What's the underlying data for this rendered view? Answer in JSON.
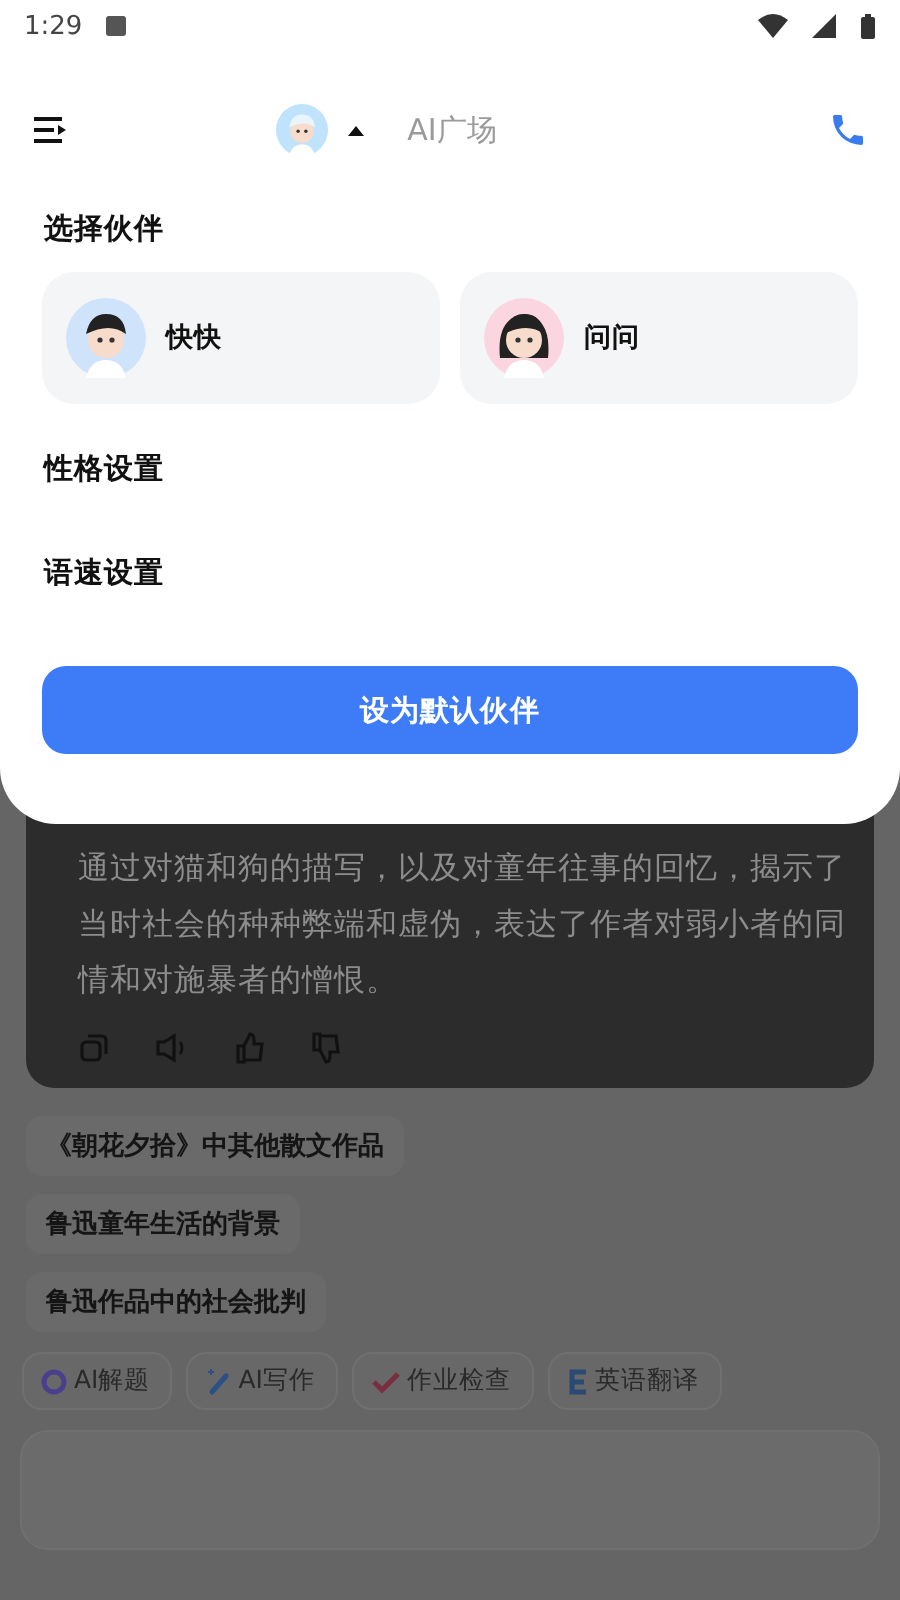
{
  "status_bar": {
    "time": "1:29"
  },
  "header": {
    "title": "AI广场"
  },
  "panel": {
    "section_title": "选择伙伴",
    "partners": [
      {
        "name": "快快",
        "kind": "boy"
      },
      {
        "name": "问问",
        "kind": "girl"
      }
    ],
    "settings": [
      "性格设置",
      "语速设置"
    ],
    "button": "设为默认伙伴"
  },
  "answer": {
    "lines": [
      "通过对猫和狗的描写，以及对童年往事的回忆，揭示了",
      "当时社会的种种弊端和虚伪，表达了作者对弱小者的同",
      "情和对施暴者的憎恨。"
    ]
  },
  "suggestions": [
    "《朝花夕拾》中其他散文作品",
    "鲁迅童年生活的背景",
    "鲁迅作品中的社会批判"
  ],
  "tools": [
    {
      "label": "AI解题",
      "kind": "solve"
    },
    {
      "label": "AI写作",
      "kind": "write"
    },
    {
      "label": "作业检查",
      "kind": "check"
    },
    {
      "label": "英语翻译",
      "kind": "translate"
    }
  ]
}
